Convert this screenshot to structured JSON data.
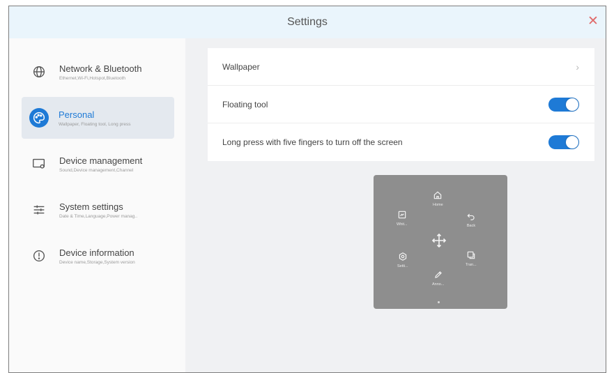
{
  "window": {
    "title": "Settings"
  },
  "sidebar": {
    "items": [
      {
        "label": "Network & Bluetooth",
        "sub": "Ethernet,Wi-Fi,Hotspot,Bluetooth",
        "icon": "globe-icon",
        "active": false
      },
      {
        "label": "Personal",
        "sub": "Wallpaper, Floating tool, Long press",
        "icon": "palette-icon",
        "active": true
      },
      {
        "label": "Device management",
        "sub": "Sound,Device management,Channel",
        "icon": "device-icon",
        "active": false
      },
      {
        "label": "System settings",
        "sub": "Date & Time,Language,Power manag..",
        "icon": "sliders-icon",
        "active": false
      },
      {
        "label": "Device information",
        "sub": "Device name,Storage,System version",
        "icon": "info-icon",
        "active": false
      }
    ]
  },
  "main": {
    "rows": [
      {
        "label": "Wallpaper",
        "control": "chevron",
        "icon": "chevron-right-icon"
      },
      {
        "label": "Floating tool",
        "control": "toggle",
        "on": true
      },
      {
        "label": "Long press with five fingers to turn off the screen",
        "control": "toggle",
        "on": true
      }
    ]
  },
  "floating_tool": {
    "items": [
      {
        "label": "Home",
        "icon": "home-icon"
      },
      {
        "label": "Whit...",
        "icon": "whiteboard-icon"
      },
      {
        "label": "Back",
        "icon": "back-icon"
      },
      {
        "label": "Setti...",
        "icon": "settings-icon"
      },
      {
        "label": "Tran...",
        "icon": "translate-icon"
      },
      {
        "label": "Anno...",
        "icon": "pen-icon"
      }
    ],
    "move_icon": "move-icon"
  },
  "colors": {
    "accent": "#1e7ad6",
    "close": "#e06a6a",
    "titlebar": "#eaf5fc",
    "panel": "#8e8e8e"
  }
}
